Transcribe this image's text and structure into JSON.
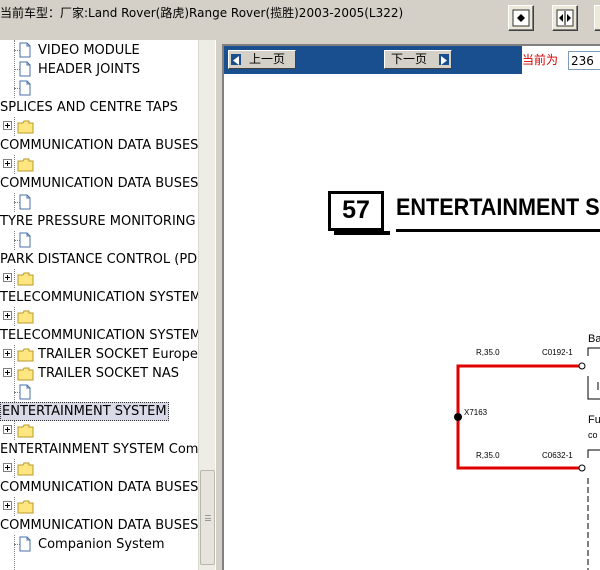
{
  "window": {
    "title": "当前车型：厂家:Land Rover(路虎)Range Rover(揽胜)2003-2005(L322)",
    "buttons": [
      {
        "name": "fit-page-button",
        "icon": "fit-page-icon"
      },
      {
        "name": "fit-width-button",
        "icon": "fit-width-icon"
      },
      {
        "name": "zoom-button",
        "icon": "zoom-icon"
      }
    ]
  },
  "tree": {
    "items": [
      {
        "label": "VIDEO MODULE",
        "type": "doc",
        "indent": 1
      },
      {
        "label": "HEADER JOINTS",
        "type": "doc",
        "indent": 1
      },
      {
        "label": "",
        "type": "doc",
        "indent": 1
      },
      {
        "label": "SPLICES AND CENTRE TAPS",
        "type": "text",
        "indent": 0
      },
      {
        "label": "",
        "type": "folder",
        "indent": 0
      },
      {
        "label": "COMMUNICATION DATA BUSES",
        "type": "text",
        "indent": 0
      },
      {
        "label": "",
        "type": "folder",
        "indent": 0
      },
      {
        "label": "COMMUNICATION DATA BUSES",
        "type": "text",
        "indent": 0
      },
      {
        "label": "",
        "type": "doc",
        "indent": 1
      },
      {
        "label": "TYRE PRESSURE MONITORING",
        "type": "text",
        "indent": 0
      },
      {
        "label": "",
        "type": "doc",
        "indent": 1
      },
      {
        "label": "PARK DISTANCE CONTROL (PDC)",
        "type": "text",
        "indent": 0
      },
      {
        "label": "",
        "type": "folder",
        "indent": 0
      },
      {
        "label": "TELECOMMUNICATION SYSTEM",
        "type": "text",
        "indent": 0
      },
      {
        "label": "",
        "type": "folder",
        "indent": 0
      },
      {
        "label": "TELECOMMUNICATION SYSTEM",
        "type": "text",
        "indent": 0
      },
      {
        "label": "TRAILER SOCKET Europe",
        "type": "folder",
        "indent": 1
      },
      {
        "label": "TRAILER SOCKET NAS",
        "type": "folder",
        "indent": 1
      },
      {
        "label": "",
        "type": "doc",
        "indent": 1
      },
      {
        "label": "ENTERTAINMENT SYSTEM",
        "type": "text",
        "indent": 0,
        "selected": true
      },
      {
        "label": "",
        "type": "folder",
        "indent": 0
      },
      {
        "label": "ENTERTAINMENT SYSTEM Com",
        "type": "text",
        "indent": 0
      },
      {
        "label": "",
        "type": "folder",
        "indent": 0
      },
      {
        "label": "COMMUNICATION DATA BUSES",
        "type": "text",
        "indent": 0
      },
      {
        "label": "",
        "type": "folder",
        "indent": 0
      },
      {
        "label": "COMMUNICATION DATA BUSES",
        "type": "text",
        "indent": 0
      },
      {
        "label": "Companion System",
        "type": "doc",
        "indent": 1
      }
    ]
  },
  "nav": {
    "prev_label": "上一页",
    "next_label": "下一页",
    "page_label": "当前为",
    "page_value": "236"
  },
  "document": {
    "page_number": "57",
    "section_title": "ENTERTAINMENT SYSTEM",
    "wire_top": "R,35.0",
    "conn_top": "C0192-1",
    "wire_bottom": "R,35.0",
    "conn_bottom": "C0632-1",
    "splice": "X7163",
    "label_right_top": "Ba",
    "label_right_mid": "Fu",
    "label_right_mid2": "co",
    "wire_color": "#e00000"
  }
}
